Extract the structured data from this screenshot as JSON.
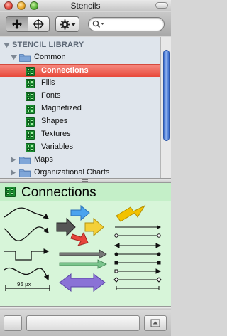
{
  "window": {
    "title": "Stencils"
  },
  "toolbar": {
    "view_mode_icons": [
      "move-tool-icon",
      "crosshair-tool-icon"
    ],
    "action_menu_icon": "gear-icon",
    "search": {
      "value": "",
      "placeholder": ""
    }
  },
  "library": {
    "header": "STENCIL LIBRARY",
    "folders": [
      {
        "label": "Common",
        "expanded": true
      },
      {
        "label": "Maps",
        "expanded": false
      },
      {
        "label": "Organizational Charts",
        "expanded": false
      }
    ],
    "items": [
      {
        "label": "Connections",
        "selected": true
      },
      {
        "label": "Fills",
        "selected": false
      },
      {
        "label": "Fonts",
        "selected": false
      },
      {
        "label": "Magnetized",
        "selected": false
      },
      {
        "label": "Shapes",
        "selected": false
      },
      {
        "label": "Textures",
        "selected": false
      },
      {
        "label": "Variables",
        "selected": false
      }
    ]
  },
  "preview": {
    "title": "Connections",
    "dimension_label": "95 px"
  },
  "colors": {
    "selection": "#e8483a",
    "sidebar_bg": "#dfe5ec",
    "preview_bg": "#d7f5d9",
    "stencil_icon": "#1c8e32",
    "folder": "#7fa6d8"
  }
}
